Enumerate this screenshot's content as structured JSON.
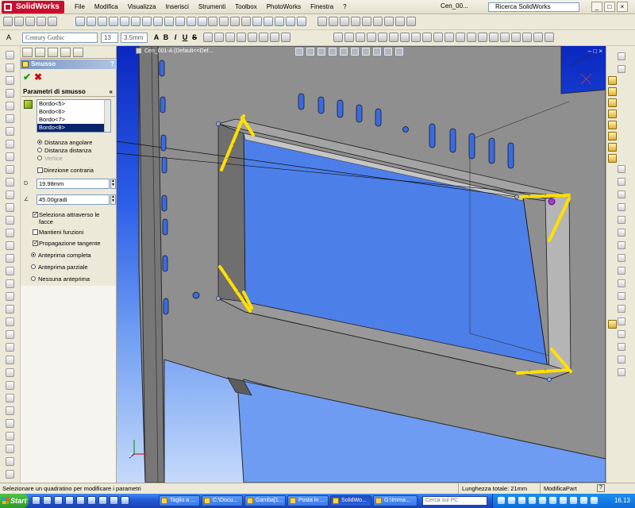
{
  "app": {
    "logo": "SolidWorks",
    "menu": [
      "File",
      "Modifica",
      "Visualizza",
      "Inserisci",
      "Strumenti",
      "Toolbox",
      "PhotoWorks",
      "Finestra",
      "?"
    ],
    "doc_title": "Cen_00...",
    "search_placeholder": "Ricerca SolidWorks"
  },
  "format_toolbar": {
    "font": "Century Gothic",
    "size": "13",
    "spacing": "3.5mm",
    "bold": "B",
    "italic": "I",
    "underline": "U",
    "strike": "S"
  },
  "property_manager": {
    "title": "Smusso",
    "help": "?",
    "group_title": "Parametri di smusso",
    "edges": [
      {
        "label": "Bordo<5>",
        "selected": false
      },
      {
        "label": "Bordo<6>",
        "selected": false
      },
      {
        "label": "Bordo<7>",
        "selected": false
      },
      {
        "label": "Bordo<8>",
        "selected": true
      }
    ],
    "type_options": [
      {
        "label": "Distanza angolare",
        "selected": true,
        "enabled": true
      },
      {
        "label": "Distanza distanza",
        "selected": false,
        "enabled": true
      },
      {
        "label": "Vertice",
        "selected": false,
        "enabled": false
      }
    ],
    "flip_direction": "Direzione contraria",
    "distance": "19.98mm",
    "angle": "45.00gradi",
    "distance_icon": "D",
    "options": [
      {
        "label": "Seleziona attraverso le facce",
        "checked": true
      },
      {
        "label": "Mantieni funzioni",
        "checked": false
      },
      {
        "label": "Propagazione tangente",
        "checked": true
      }
    ],
    "preview_options": [
      {
        "label": "Anteprima completa",
        "selected": true
      },
      {
        "label": "Anteprima parziale",
        "selected": false
      },
      {
        "label": "Nessuna anteprima",
        "selected": false
      }
    ]
  },
  "viewport": {
    "title": "Cen_001-A (Default<<Def...",
    "colors": {
      "sheet": "#8f8f8f",
      "sheet_shadow": "#5d5d5d",
      "edge_hilite": "#ffe000",
      "point": "#a040d0"
    }
  },
  "status": {
    "message": "Selezionare un quadratino per modificare i parametri",
    "length": "Lunghezza totale: 21mm",
    "mode": "ModificaPart",
    "help": "?"
  },
  "taskbar": {
    "start": "Start",
    "tasks": [
      {
        "label": "Taglio a ...",
        "active": false
      },
      {
        "label": "C:\\Docu...",
        "active": false
      },
      {
        "label": "Gamba[1...",
        "active": false
      },
      {
        "label": "Posta in ...",
        "active": false
      },
      {
        "label": "SolidWo...",
        "active": true
      },
      {
        "label": "G:\\Imma...",
        "active": false
      }
    ],
    "search": "Cerca sul PC",
    "clock": "16.13"
  }
}
